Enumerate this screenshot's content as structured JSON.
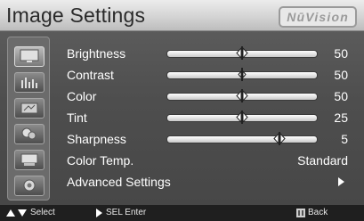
{
  "header": {
    "title": "Image Settings",
    "brand": "NūVision"
  },
  "sidebar": {
    "icons": [
      {
        "name": "picture-menu-icon",
        "active": true
      },
      {
        "name": "audio-menu-icon",
        "active": false
      },
      {
        "name": "setup-menu-icon",
        "active": false
      },
      {
        "name": "options-menu-icon",
        "active": false
      },
      {
        "name": "input-menu-icon",
        "active": false
      },
      {
        "name": "settings-menu-icon",
        "active": false
      }
    ]
  },
  "settings": [
    {
      "label": "Brightness",
      "value": "50",
      "level": 0.5
    },
    {
      "label": "Contrast",
      "value": "50",
      "level": 0.5
    },
    {
      "label": "Color",
      "value": "50",
      "level": 0.5
    },
    {
      "label": "Tint",
      "value": "25",
      "level": 0.5
    },
    {
      "label": "Sharpness",
      "value": "5",
      "level": 0.75
    }
  ],
  "color_temp": {
    "label": "Color Temp.",
    "value": "Standard"
  },
  "advanced": {
    "label": "Advanced Settings"
  },
  "footer": {
    "select_label": "Select",
    "enter_label": "SEL Enter",
    "back_label": "Back"
  }
}
